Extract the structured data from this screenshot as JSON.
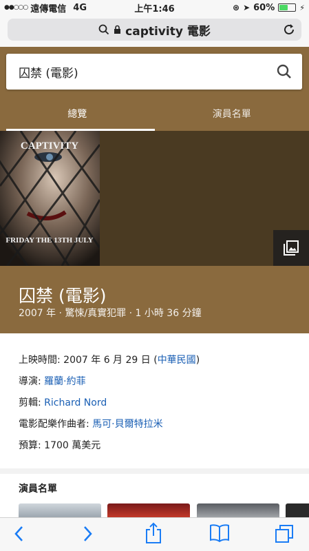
{
  "status": {
    "carrier": "遠傳電信",
    "network": "4G",
    "time": "上午1:46",
    "battery": "60%",
    "battery_level": 0.6
  },
  "address_bar": {
    "query": "captivity 電影"
  },
  "search": {
    "query": "囚禁 (電影)"
  },
  "tabs": [
    {
      "label": "總覽",
      "active": true
    },
    {
      "label": "演員名單",
      "active": false
    }
  ],
  "poster": {
    "title": "CAPTIVITY",
    "tagline": "FRIDAY THE 13TH JULY"
  },
  "movie": {
    "title": "囚禁 (電影)",
    "subtitle": "2007 年 · 驚悚/真實犯罪 · 1 小時 36 分鐘"
  },
  "facts": {
    "release_label": "上映時間: ",
    "release_value": "2007 年 6 月 29 日 (",
    "release_link": "中華民國",
    "release_end": ")",
    "director_label": "導演: ",
    "director_link": "羅蘭·約菲",
    "editor_label": "剪輯: ",
    "editor_link": "Richard Nord",
    "composer_label": "電影配樂作曲者: ",
    "composer_link": "馬可·貝爾特拉米",
    "budget_label": "預算: ",
    "budget_value": "1700 萬美元"
  },
  "cast": {
    "heading": "演員名單"
  },
  "colors": {
    "brand_brown": "#8a6a3e",
    "link_blue": "#1a5fb4",
    "toolbar_blue": "#1a7cf5"
  }
}
